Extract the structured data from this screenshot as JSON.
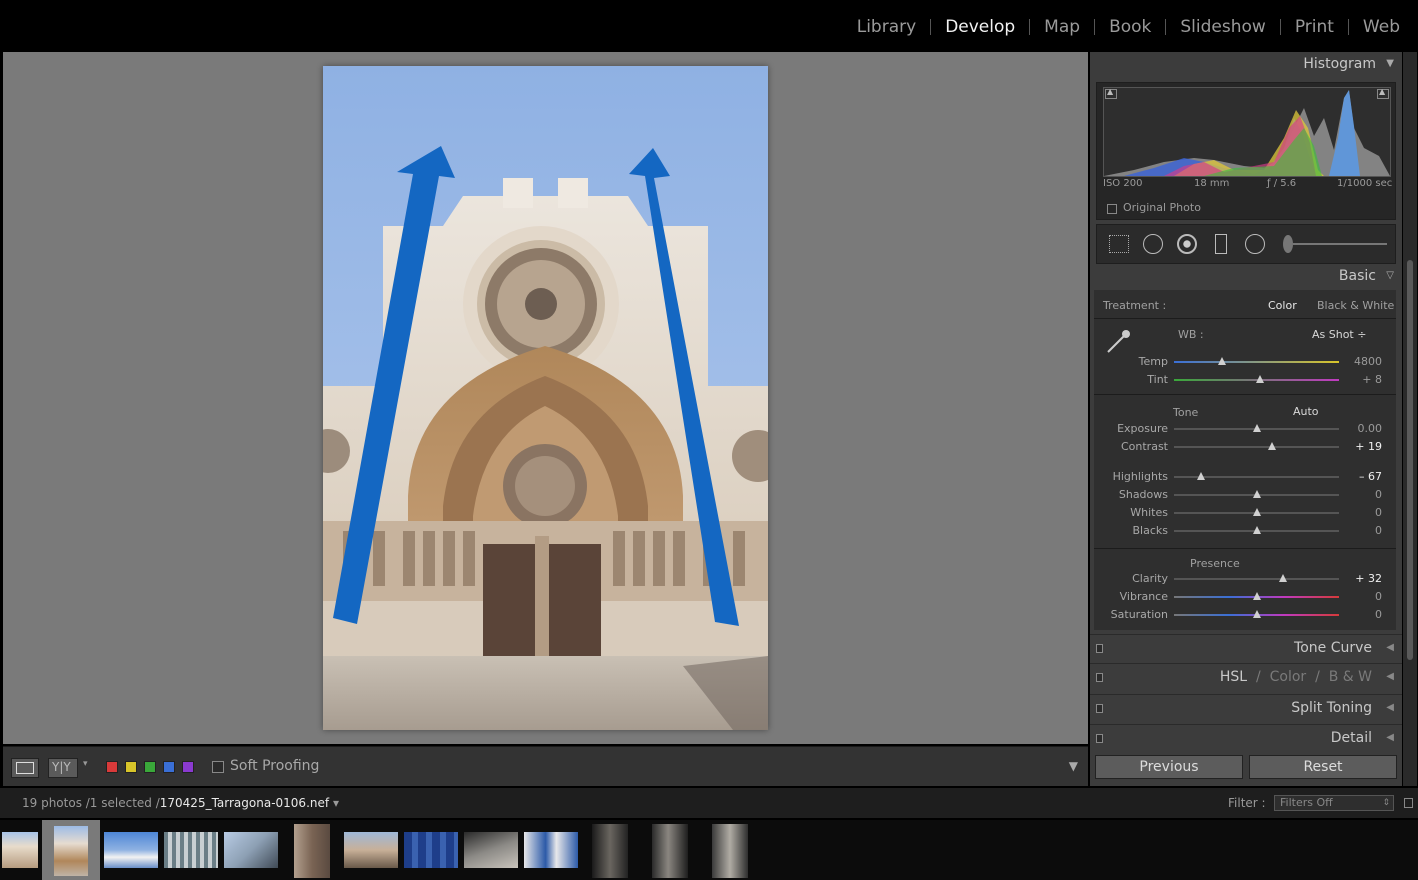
{
  "modules": [
    {
      "label": "Library",
      "active": false
    },
    {
      "label": "Develop",
      "active": true
    },
    {
      "label": "Map",
      "active": false
    },
    {
      "label": "Book",
      "active": false
    },
    {
      "label": "Slideshow",
      "active": false
    },
    {
      "label": "Print",
      "active": false
    },
    {
      "label": "Web",
      "active": false
    }
  ],
  "toolbar": {
    "soft_proofing_label": "Soft Proofing",
    "color_labels": [
      "#d93a3a",
      "#d8c52a",
      "#3aa83a",
      "#3a6fd6",
      "#8a3ad0"
    ]
  },
  "histogram": {
    "title": "Histogram",
    "iso": "ISO 200",
    "focal": "18 mm",
    "aperture": "ƒ / 5.6",
    "shutter": "1/1000 sec",
    "original_photo_label": "Original Photo"
  },
  "basic": {
    "title": "Basic",
    "treatment_label": "Treatment :",
    "treatment_color": "Color",
    "treatment_bw": "Black & White",
    "wb_label": "WB :",
    "wb_value": "As Shot ÷",
    "tone_label": "Tone",
    "auto_label": "Auto",
    "presence_label": "Presence",
    "sliders": {
      "temp": {
        "label": "Temp",
        "value": "4800",
        "pos": 0.29
      },
      "tint": {
        "label": "Tint",
        "value": "+ 8",
        "pos": 0.52
      },
      "exposure": {
        "label": "Exposure",
        "value": "0.00",
        "pos": 0.5
      },
      "contrast": {
        "label": "Contrast",
        "value": "+ 19",
        "pos": 0.595
      },
      "highlights": {
        "label": "Highlights",
        "value": "– 67",
        "pos": 0.165
      },
      "shadows": {
        "label": "Shadows",
        "value": "0",
        "pos": 0.5
      },
      "whites": {
        "label": "Whites",
        "value": "0",
        "pos": 0.5
      },
      "blacks": {
        "label": "Blacks",
        "value": "0",
        "pos": 0.5
      },
      "clarity": {
        "label": "Clarity",
        "value": "+ 32",
        "pos": 0.66
      },
      "vibrance": {
        "label": "Vibrance",
        "value": "0",
        "pos": 0.5
      },
      "saturation": {
        "label": "Saturation",
        "value": "0",
        "pos": 0.5
      }
    }
  },
  "panels": {
    "tone_curve": "Tone Curve",
    "hsl": "HSL",
    "hsl_color": "Color",
    "hsl_bw": "B & W",
    "hsl_sep": "/",
    "split_toning": "Split Toning",
    "detail": "Detail"
  },
  "buttons": {
    "previous": "Previous",
    "reset": "Reset"
  },
  "filmstrip": {
    "count_text": "19 photos /1 selected /",
    "filename": "170425_Tarragona-0106.nef",
    "filter_label": "Filter :",
    "filter_value": "Filters Off"
  }
}
